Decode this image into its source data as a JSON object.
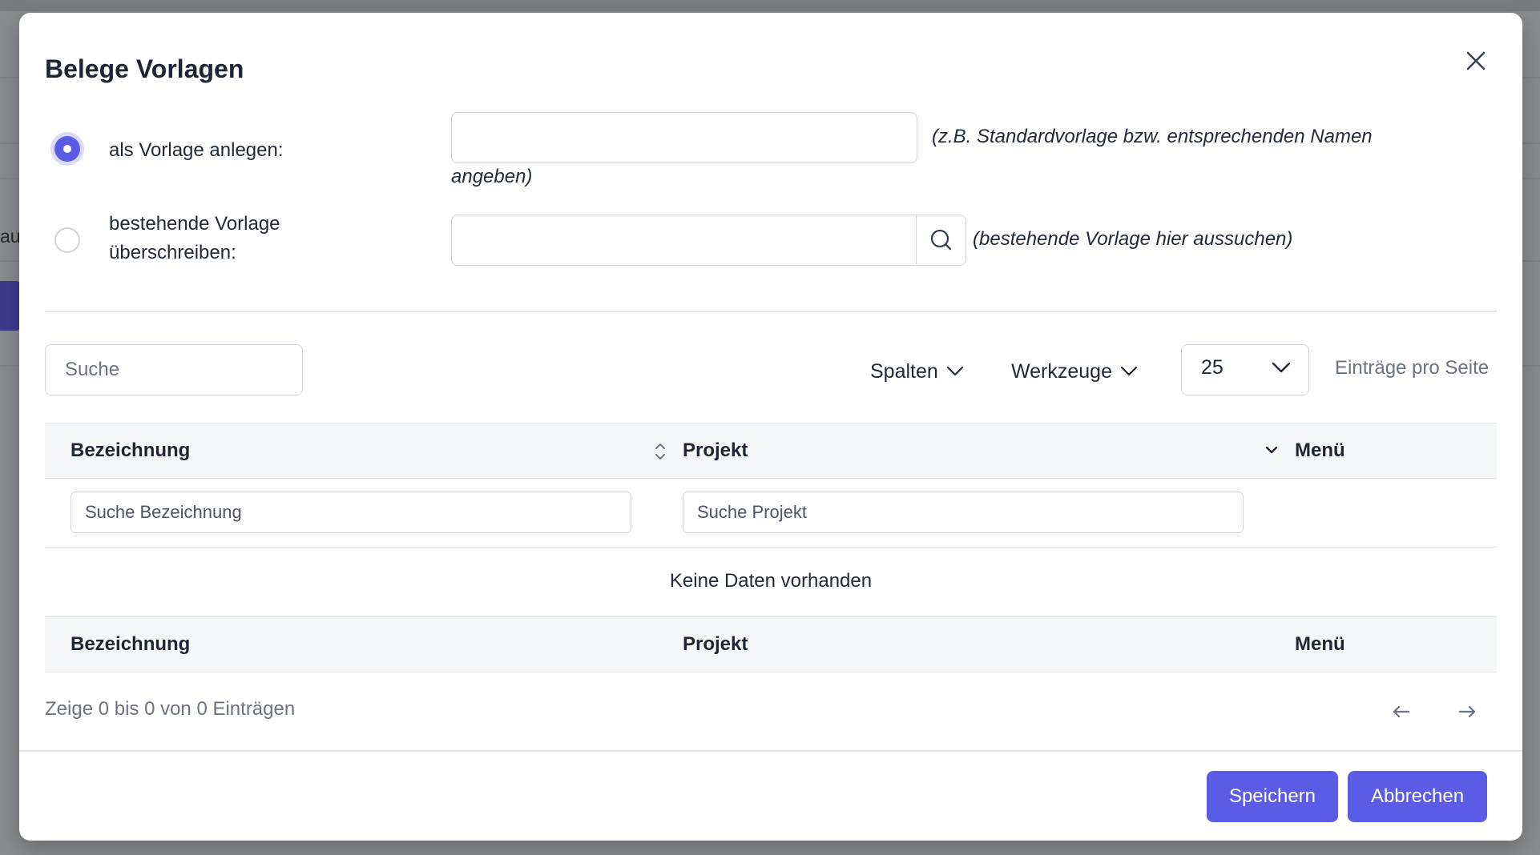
{
  "background": {
    "partial_text": "au"
  },
  "modal": {
    "title": "Belege Vorlagen",
    "close_icon": "close-icon"
  },
  "options": {
    "create": {
      "label": "als Vorlage anlegen:",
      "value": "",
      "hint_line1": "(z.B. Standardvorlage bzw. entsprechenden Namen",
      "hint_line2": "angeben)",
      "checked": true
    },
    "overwrite": {
      "label_line1": "bestehende Vorlage",
      "label_line2": "überschreiben:",
      "value": "",
      "hint": "(bestehende Vorlage hier aussuchen)",
      "checked": false,
      "search_icon": "search-icon"
    }
  },
  "toolbar": {
    "search_placeholder": "Suche",
    "columns_label": "Spalten",
    "tools_label": "Werkzeuge",
    "page_size": "25",
    "per_page_label": "Einträge pro Seite"
  },
  "table": {
    "headers": [
      "Bezeichnung",
      "Projekt",
      "Menü"
    ],
    "filters": {
      "bezeichnung_placeholder": "Suche Bezeichnung",
      "projekt_placeholder": "Suche Projekt"
    },
    "empty_text": "Keine Daten vorhanden",
    "footers": [
      "Bezeichnung",
      "Projekt",
      "Menü"
    ]
  },
  "pagination": {
    "info": "Zeige 0 bis 0 von 0 Einträgen",
    "prev_icon": "arrow-left-icon",
    "next_icon": "arrow-right-icon"
  },
  "footer": {
    "save_label": "Speichern",
    "cancel_label": "Abbrechen"
  },
  "colors": {
    "primary": "#5b5be6",
    "border": "#d1d5db",
    "header_bg": "#f6f7f9"
  }
}
